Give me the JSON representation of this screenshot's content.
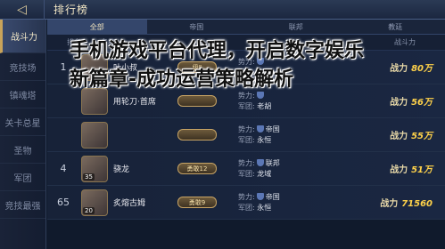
{
  "header": {
    "back_icon": "back-arrow-icon",
    "title": "排行榜"
  },
  "sidebar": {
    "items": [
      {
        "label": "战斗力",
        "active": true
      },
      {
        "label": "竞技场"
      },
      {
        "label": "镇魂塔"
      },
      {
        "label": "关卡总星"
      },
      {
        "label": "圣物"
      },
      {
        "label": "军团"
      },
      {
        "label": "竞技最强"
      }
    ]
  },
  "tabs": [
    {
      "label": "全部",
      "active": true
    },
    {
      "label": "帝国"
    },
    {
      "label": "联邦"
    },
    {
      "label": "教廷"
    }
  ],
  "columns": {
    "rank": "排名",
    "name": "名称",
    "power": "战斗力"
  },
  "rows": [
    {
      "rank": "1",
      "level": "",
      "name": "叶小叔",
      "badge": "级Ⅱ",
      "camp_key": "势力:",
      "camp": "",
      "guild_key": "军团:",
      "guild": "永恒",
      "power_key": "战力",
      "power": "80万"
    },
    {
      "rank": "",
      "level": "",
      "name": "用轮刀·首席",
      "badge": "",
      "camp_key": "势力:",
      "camp": "",
      "guild_key": "军团:",
      "guild": "老胡",
      "power_key": "战力",
      "power": "56万"
    },
    {
      "rank": "",
      "level": "",
      "name": "",
      "badge": "",
      "camp_key": "势力:",
      "camp": "帝国",
      "guild_key": "军团:",
      "guild": "永恒",
      "power_key": "战力",
      "power": "55万"
    },
    {
      "rank": "4",
      "level": "35",
      "name": "骁龙",
      "badge": "勇敢12",
      "camp_key": "势力:",
      "camp": "联邦",
      "guild_key": "军团:",
      "guild": "龙域",
      "power_key": "战力",
      "power": "51万"
    },
    {
      "rank": "65",
      "level": "20",
      "name": "炙熔古姆",
      "badge": "勇敢9",
      "camp_key": "势力:",
      "camp": "帝国",
      "guild_key": "军团:",
      "guild": "永恒",
      "power_key": "战力",
      "power": "71560"
    }
  ],
  "watermark": "手机游戏平台代理，开启数字娱乐新篇章-成功运营策略解析"
}
